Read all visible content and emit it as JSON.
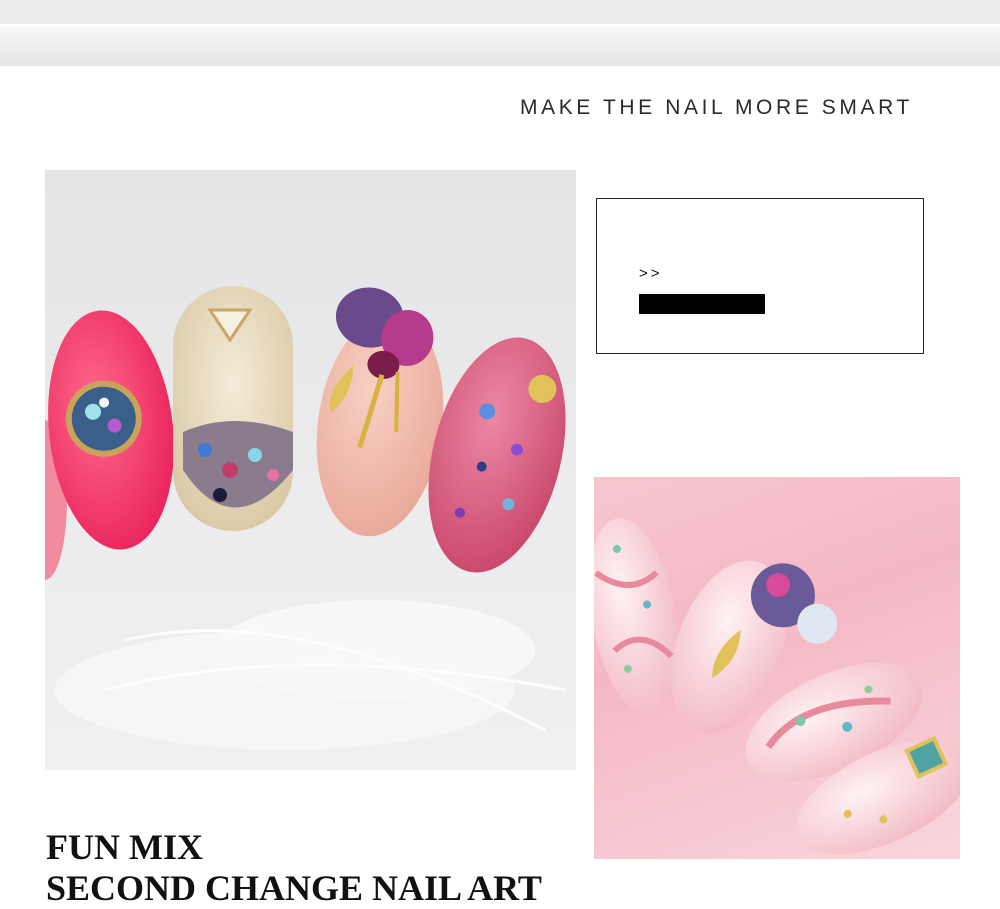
{
  "header": {
    "tagline": "MAKE THE NAIL MORE SMART"
  },
  "info_box": {
    "arrows": ">>"
  },
  "headline": {
    "line1": "FUN MIX",
    "line2": "SECOND CHANGE NAIL ART"
  },
  "colors": {
    "text": "#111111",
    "hot_pink": "#f5376a",
    "rose_glitter": "#d9567a",
    "nude": "#efb6a6",
    "gold": "#e1c25a",
    "soft_pink_bg": "#f4b8c4"
  }
}
